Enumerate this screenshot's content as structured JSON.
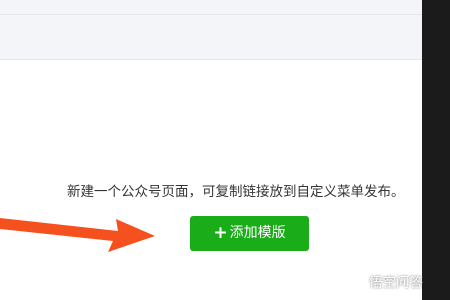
{
  "colors": {
    "primary_button": "#1aad19",
    "arrow": "#f5511e",
    "side_bar": "#1b1b1b",
    "top_panel": "#f4f5f9"
  },
  "main": {
    "description": "新建一个公众号页面，可复制链接放到自定义菜单发布。",
    "add_button": {
      "icon": "plus-icon",
      "icon_text": "+",
      "label": "添加模版"
    }
  },
  "annotation": {
    "icon": "arrow-right-icon"
  },
  "watermark": {
    "icon": "speech-bubble-logo",
    "text": "悟空问答"
  }
}
